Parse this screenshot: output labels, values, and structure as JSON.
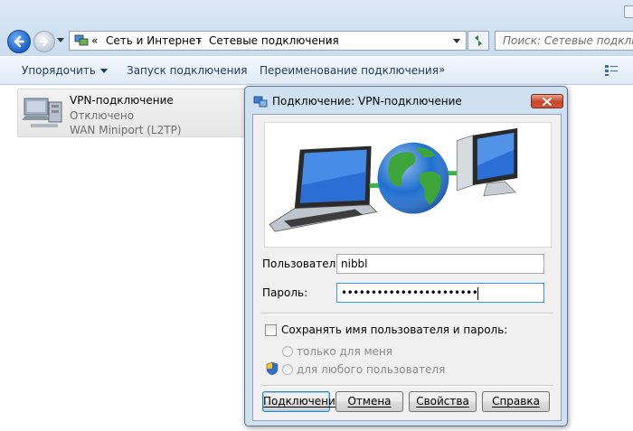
{
  "explorer": {
    "breadcrumb_prefix": "«",
    "breadcrumb": [
      "Сеть и Интернет",
      "Сетевые подключения"
    ],
    "search_placeholder": "Поиск: Сетевые подключе",
    "commands": [
      "Упорядочить",
      "Запуск подключения",
      "Переименование подключения",
      "»"
    ]
  },
  "connection_item": {
    "name": "VPN-подключение",
    "status": "Отключено",
    "device": "WAN Miniport (L2TP)"
  },
  "dialog": {
    "title": "Подключение: VPN-подключение",
    "username_label": "Пользователь:",
    "username_value": "nibbl",
    "password_label": "Пароль:",
    "password_mask": "•••••••••••••••••••••••",
    "save_credentials_label": "Сохранять имя пользователя и пароль:",
    "only_me_label": "только для меня",
    "any_user_label": "для любого пользователя",
    "buttons": {
      "connect": "Подключение",
      "cancel": "Отмена",
      "properties": "Свойства",
      "help": "Справка"
    }
  },
  "colors": {
    "accent_blue": "#3399ff",
    "close_red": "#c8452a",
    "dialog_frame": "#cfe0f1"
  }
}
